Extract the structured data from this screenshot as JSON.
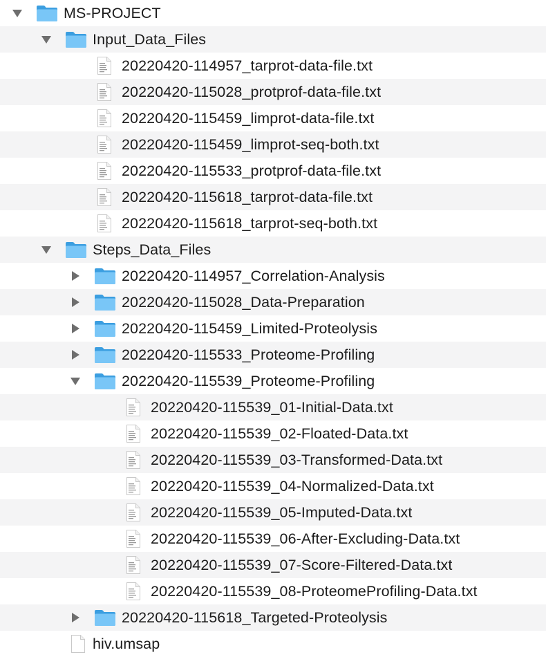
{
  "colors": {
    "folder_body": "#56b4ef",
    "folder_tab": "#3b9ee0",
    "folder_front": "#79c6f7",
    "file_page": "#ffffff",
    "file_border": "#c9c9c9",
    "file_lines": "#9a9a9a",
    "disclosure": "#6e6e6e",
    "stripe": "#f4f4f5"
  },
  "icons": {
    "folder": "folder-icon",
    "file": "text-file-icon",
    "document": "document-icon",
    "expanded": "triangle-down-icon",
    "collapsed": "triangle-right-icon"
  },
  "tree": [
    {
      "label": "MS-PROJECT",
      "type": "folder",
      "depth": 0,
      "expanded": true
    },
    {
      "label": "Input_Data_Files",
      "type": "folder",
      "depth": 1,
      "expanded": true
    },
    {
      "label": "20220420-114957_tarprot-data-file.txt",
      "type": "file",
      "depth": 2
    },
    {
      "label": "20220420-115028_protprof-data-file.txt",
      "type": "file",
      "depth": 2
    },
    {
      "label": "20220420-115459_limprot-data-file.txt",
      "type": "file",
      "depth": 2
    },
    {
      "label": "20220420-115459_limprot-seq-both.txt",
      "type": "file",
      "depth": 2
    },
    {
      "label": "20220420-115533_protprof-data-file.txt",
      "type": "file",
      "depth": 2
    },
    {
      "label": "20220420-115618_tarprot-data-file.txt",
      "type": "file",
      "depth": 2
    },
    {
      "label": "20220420-115618_tarprot-seq-both.txt",
      "type": "file",
      "depth": 2
    },
    {
      "label": "Steps_Data_Files",
      "type": "folder",
      "depth": 1,
      "expanded": true
    },
    {
      "label": "20220420-114957_Correlation-Analysis",
      "type": "folder",
      "depth": 2,
      "expanded": false
    },
    {
      "label": "20220420-115028_Data-Preparation",
      "type": "folder",
      "depth": 2,
      "expanded": false
    },
    {
      "label": "20220420-115459_Limited-Proteolysis",
      "type": "folder",
      "depth": 2,
      "expanded": false
    },
    {
      "label": "20220420-115533_Proteome-Profiling",
      "type": "folder",
      "depth": 2,
      "expanded": false
    },
    {
      "label": "20220420-115539_Proteome-Profiling",
      "type": "folder",
      "depth": 2,
      "expanded": true
    },
    {
      "label": "20220420-115539_01-Initial-Data.txt",
      "type": "file",
      "depth": 3
    },
    {
      "label": "20220420-115539_02-Floated-Data.txt",
      "type": "file",
      "depth": 3
    },
    {
      "label": "20220420-115539_03-Transformed-Data.txt",
      "type": "file",
      "depth": 3
    },
    {
      "label": "20220420-115539_04-Normalized-Data.txt",
      "type": "file",
      "depth": 3
    },
    {
      "label": "20220420-115539_05-Imputed-Data.txt",
      "type": "file",
      "depth": 3
    },
    {
      "label": "20220420-115539_06-After-Excluding-Data.txt",
      "type": "file",
      "depth": 3
    },
    {
      "label": "20220420-115539_07-Score-Filtered-Data.txt",
      "type": "file",
      "depth": 3
    },
    {
      "label": "20220420-115539_08-ProteomeProfiling-Data.txt",
      "type": "file",
      "depth": 3
    },
    {
      "label": "20220420-115618_Targeted-Proteolysis",
      "type": "folder",
      "depth": 2,
      "expanded": false
    },
    {
      "label": "hiv.umsap",
      "type": "document",
      "depth": 1
    }
  ]
}
